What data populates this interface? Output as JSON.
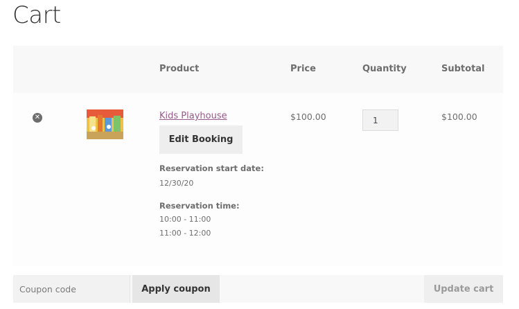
{
  "page": {
    "title": "Cart"
  },
  "table": {
    "headers": {
      "product": "Product",
      "price": "Price",
      "quantity": "Quantity",
      "subtotal": "Subtotal"
    },
    "row": {
      "remove_icon": "remove-circle-icon",
      "thumbnail": "kids-playhouse-image",
      "product_name": "Kids Playhouse",
      "edit_button": "Edit Booking",
      "reservation_start_label": "Reservation start date:",
      "reservation_start_value": "12/30/20",
      "reservation_time_label": "Reservation time:",
      "reservation_times": [
        "10:00 - 11:00",
        "11:00 - 12:00"
      ],
      "price": "$100.00",
      "quantity": "1",
      "subtotal": "$100.00"
    }
  },
  "actions": {
    "coupon_placeholder": "Coupon code",
    "apply_coupon": "Apply coupon",
    "update_cart": "Update cart"
  },
  "colors": {
    "link": "#96588a",
    "header_bg": "#f8f8f8",
    "button_bg": "#eeeeee"
  }
}
